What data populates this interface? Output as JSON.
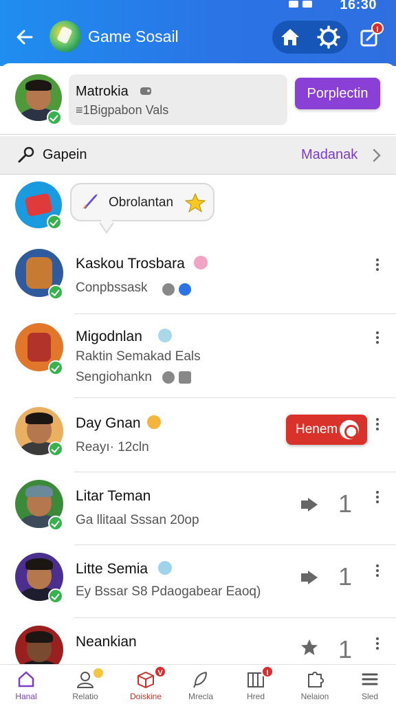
{
  "status_bar": {
    "time": "16:30"
  },
  "header": {
    "title": "Game Sosail",
    "notification_count": "I"
  },
  "profile": {
    "name": "Matrokia",
    "subtitle": "≡1Bigpabon Vals",
    "action_label": "Porplectin"
  },
  "search": {
    "label": "Gapein",
    "link": "Madanak"
  },
  "bubble": {
    "text": "Obrolantan"
  },
  "contacts": [
    {
      "name": "Kaskou Trosbara",
      "line1": "Conpbssask",
      "line2": ""
    },
    {
      "name": "Migodnlan",
      "line1": "Raktin Semakad Eals",
      "line2": "Sengiohankn"
    },
    {
      "name": "Day Gnan",
      "line1": "Reayı· 12cln",
      "line2": "",
      "action_label": "Henem"
    },
    {
      "name": "Litar Teman",
      "line1": "Ga llitaal Sssan 20op",
      "line2": "",
      "count": "1"
    },
    {
      "name": "Litte Semia",
      "line1": "Ey  Bssar  S8 Pdaogabear Eaoq)",
      "line2": "",
      "count": "1"
    },
    {
      "name": "Neankian",
      "line1": "",
      "line2": "",
      "count": "1"
    }
  ],
  "bottom_nav": [
    {
      "label": "Hanal",
      "icon": "home-icon",
      "active": true
    },
    {
      "label": "Relatio",
      "icon": "user-icon"
    },
    {
      "label": "Doiskine",
      "icon": "box-icon",
      "badge": "V"
    },
    {
      "label": "Mrecla",
      "icon": "feather-icon"
    },
    {
      "label": "Hred",
      "icon": "columns-icon",
      "badge": "I"
    },
    {
      "label": "Nelaion",
      "icon": "puzzle-icon"
    },
    {
      "label": "Sled",
      "icon": "menu-icon"
    }
  ],
  "colors": {
    "header": "#2a74e6",
    "accent_purple": "#8a3fd6",
    "accent_red": "#d8322b",
    "online": "#37b24d"
  }
}
